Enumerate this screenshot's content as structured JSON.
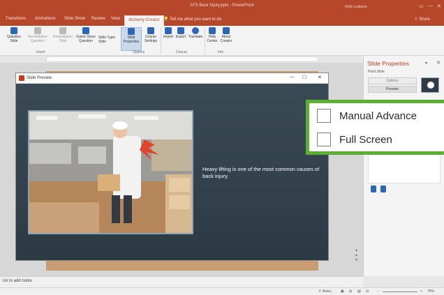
{
  "app": {
    "title": "ATS Back Injury.pptx - PowerPoint",
    "user": "Kelly Ledunne",
    "window_controls": [
      "▭",
      "—",
      "✕"
    ]
  },
  "tabs": [
    {
      "label": "Transitions"
    },
    {
      "label": "Animations"
    },
    {
      "label": "Slide Show"
    },
    {
      "label": "Review"
    },
    {
      "label": "View"
    },
    {
      "label": "Alchemy Creator",
      "active": true
    }
  ],
  "tell_me": "Tell me what you want to do",
  "share": "Share",
  "ribbon": {
    "buttons": [
      {
        "label": "Question\nSlide",
        "icon": "question-icon",
        "dim": false
      },
      {
        "label": "Remediation\nQuestion",
        "icon": "remediation-icon",
        "dim": true
      },
      {
        "label": "Remediation\nSlide",
        "icon": "remediation-slide-icon",
        "dim": true
      },
      {
        "label": "Game Show\nQuestion",
        "icon": "game-show-icon",
        "dim": false
      },
      {
        "label": "Slide Type:\nSlide",
        "icon": "",
        "dim": false
      },
      {
        "label": "Slide\nProperties",
        "icon": "slide-properties-icon",
        "dim": false,
        "selected": true
      },
      {
        "label": "Course\nSettings",
        "icon": "course-settings-icon",
        "dim": false
      },
      {
        "label": "Import",
        "icon": "import-icon",
        "dim": false
      },
      {
        "label": "Export",
        "icon": "export-icon",
        "dim": false
      },
      {
        "label": "Translate",
        "icon": "translate-icon",
        "dim": false
      },
      {
        "label": "Help\nCenter",
        "icon": "help-icon",
        "dim": false
      },
      {
        "label": "About\nCreator",
        "icon": "about-icon",
        "dim": false
      }
    ],
    "groups": [
      "Insert",
      "Options",
      "Course",
      "Info"
    ]
  },
  "preview": {
    "title": "Slide Preview",
    "caption": "Heavy lifting is one of the most common causes of back injury.",
    "controls": [
      "—",
      "☐",
      "✕"
    ]
  },
  "pane": {
    "title": "Slide Properties",
    "subtitle": "Point Slide",
    "options_label": "Options",
    "preview_label": "Preview"
  },
  "callout": {
    "items": [
      {
        "label": "Manual Advance",
        "checked": false
      },
      {
        "label": "Full Screen",
        "checked": false
      }
    ]
  },
  "notes": "ick to add notes",
  "status": {
    "notes_label": "Notes",
    "zoom": "75%"
  },
  "colors": {
    "accent": "#b7472a",
    "highlight": "#5bb033",
    "slide_bg": "#2f3c47"
  }
}
